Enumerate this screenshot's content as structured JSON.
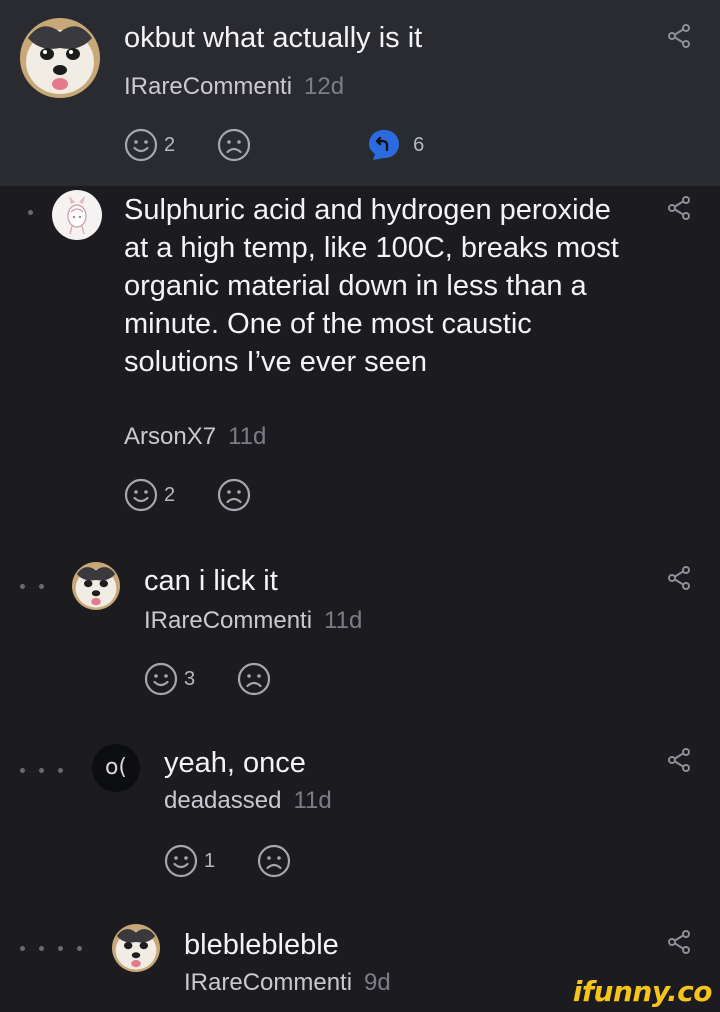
{
  "comments": [
    {
      "text": "okbut what actually is it",
      "author": "IRareCommenti",
      "time": "12d",
      "smile_count": "2",
      "replies_count": "6",
      "depth": 0,
      "avatar": "husky-avatar"
    },
    {
      "text": "Sulphuric acid and hydrogen peroxide at a high temp, like 100C, breaks most organic material down in less than a minute. One of the most caustic solutions I’ve ever seen",
      "author": "ArsonX7",
      "time": "11d",
      "smile_count": "2",
      "depth": 1,
      "avatar": "drawing-avatar"
    },
    {
      "text": "can i lick it",
      "author": "IRareCommenti",
      "time": "11d",
      "smile_count": "3",
      "depth": 2,
      "avatar": "husky-avatar"
    },
    {
      "text": "yeah, once",
      "author": "deadassed",
      "time": "11d",
      "smile_count": "1",
      "depth": 3,
      "avatar": "text-avatar",
      "avatar_text": "o("
    },
    {
      "text": "bleblebleble",
      "author": "IRareCommenti",
      "time": "9d",
      "depth": 4,
      "avatar": "husky-avatar"
    }
  ],
  "watermark": "ifunny.co",
  "colors": {
    "background": "#1b1b20",
    "highlight": "#2a2b31",
    "reply_badge": "#2a6ce0",
    "watermark": "#f7c41a"
  }
}
